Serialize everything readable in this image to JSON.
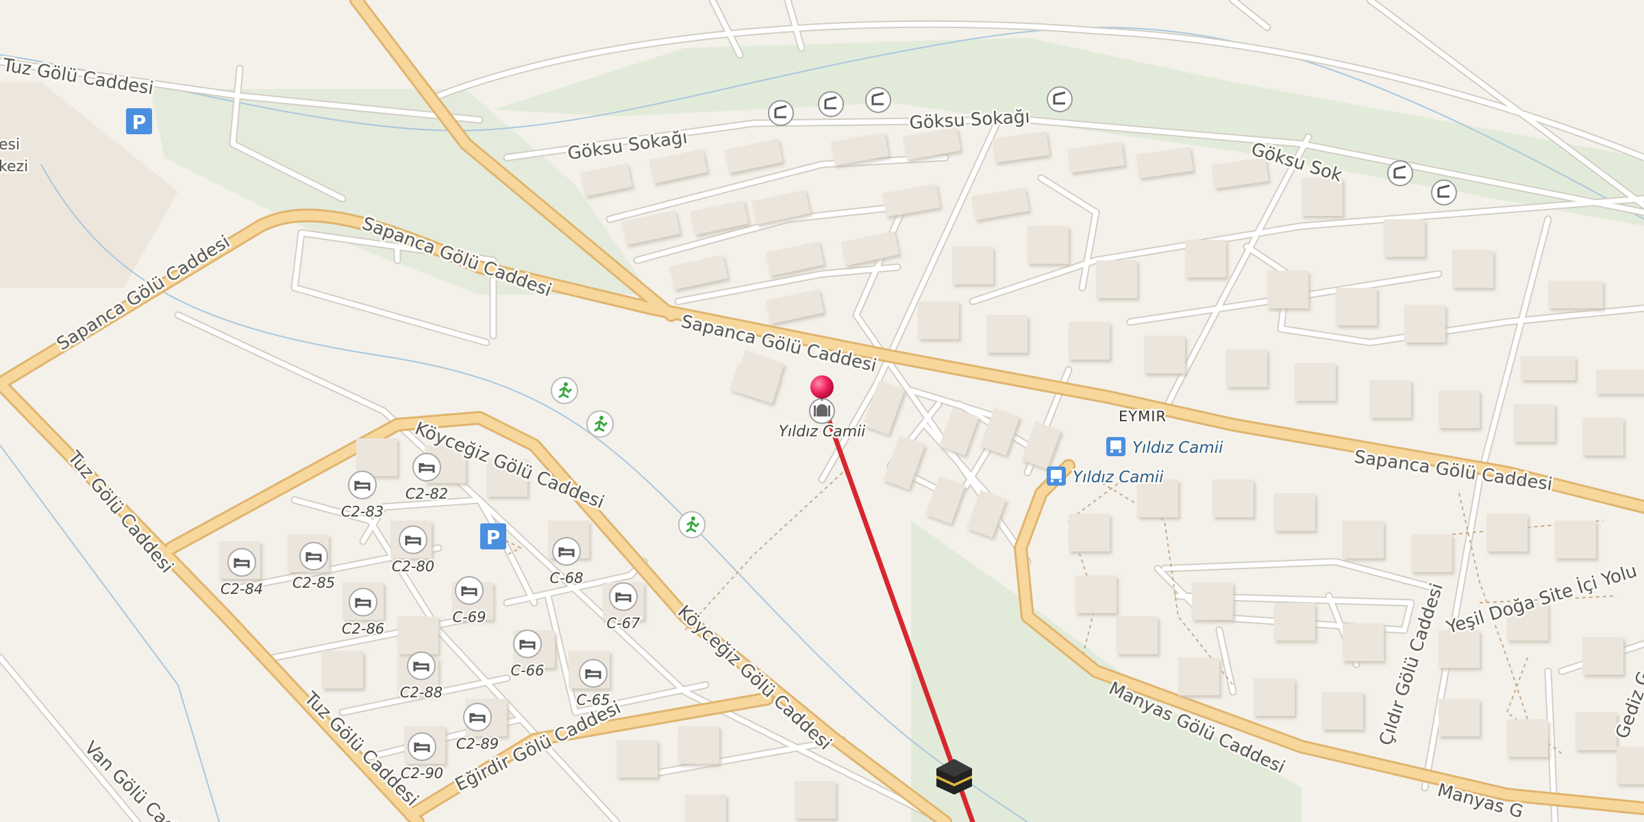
{
  "map": {
    "streets": {
      "tuz_golu_top": "Tuz Gölü Caddesi",
      "goksu_1": "Göksu Sokağı",
      "goksu_2": "Göksu Sokağı",
      "goksu_3": "Göksu Sok",
      "sapanca_1": "Sapanca Gölü Caddesi",
      "sapanca_2": "Sapanca Gölü Caddesi",
      "sapanca_3": "Sapanca Gölü Caddesi",
      "sapanca_4": "Sapanca Gölü Caddesi",
      "koycegiz_1": "Köyceğiz Gölü Caddesi",
      "koycegiz_2": "Köyceğiz Gölü Caddesi",
      "tuz_golu_left": "Tuz Gölü Caddesi",
      "tuz_golu_bottom": "Tuz Gölü Caddesi",
      "egirdir": "Eğirdir Gölü Caddesi",
      "van_golu": "Van Gölü Cad",
      "manyas_1": "Manyas Gölü Caddesi",
      "manyas_2": "Manyas G",
      "cildir": "Çıldır Gölü Caddesi",
      "yesil_doga": "Yeşil Doğa Site İçi Yolu",
      "gediz": "Gediz G",
      "eymir": "EYMIR"
    },
    "fragments": {
      "left_1": "esi",
      "left_2": "kezi"
    },
    "poi": {
      "mosque": "Yıldız Camii"
    },
    "bus_stops": [
      {
        "name": "Yıldız Camii"
      },
      {
        "name": "Yıldız Camii"
      }
    ],
    "hotels": [
      "C2-83",
      "C2-82",
      "C2-84",
      "C2-85",
      "C2-80",
      "C-68",
      "C2-86",
      "C-69",
      "C-67",
      "C2-88",
      "C-66",
      "C-65",
      "C2-89",
      "C2-90"
    ],
    "icons": {
      "parking": "P",
      "marker": "location-pin",
      "destination": "kaaba-icon",
      "route_color": "#d7262e"
    }
  }
}
